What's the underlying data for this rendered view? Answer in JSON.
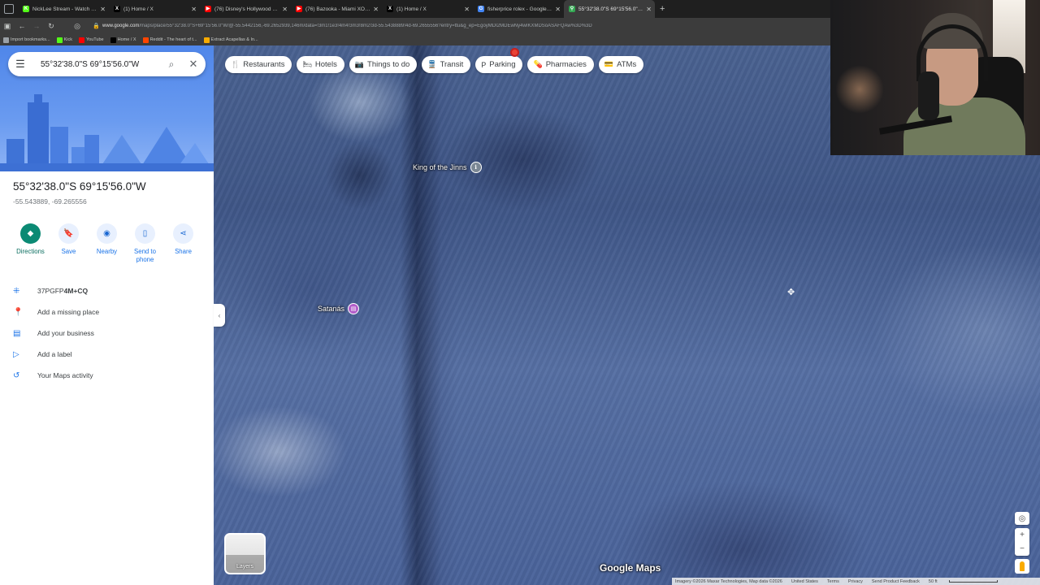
{
  "browser": {
    "tabs": [
      {
        "label": "NickLee Stream - Watch Live on",
        "color": "#53fc18",
        "glyph": "K",
        "active": false
      },
      {
        "label": "(1) Home / X",
        "color": "#000000",
        "glyph": "X",
        "active": false
      },
      {
        "label": "(76) Disney's Hollywood Studio",
        "color": "#ff0000",
        "glyph": "▶",
        "active": false
      },
      {
        "label": "(76) Bazooka - Miami XO [Offic",
        "color": "#ff0000",
        "glyph": "▶",
        "active": false
      },
      {
        "label": "(1) Home / X",
        "color": "#000000",
        "glyph": "X",
        "active": false
      },
      {
        "label": "fisherprice rolex - Google Sear",
        "color": "#4285f4",
        "glyph": "G",
        "active": false
      },
      {
        "label": "55°32'38.0\"S 69°15'56.0\"W - Go",
        "color": "#34a853",
        "glyph": "⚲",
        "active": true
      }
    ],
    "new_tab": "+",
    "url_host": "www.google.com",
    "url_rest": "/maps/place/55°32'38.0\"S+69°15'56.0\"W/@-55.5442156,-69.2652939,146m/data=!3m1!1e3!4m4!3m3!8m2!3d-55.5438889!4d-69.2655556?entry=ttu&g_ep=EgoyMDI2MDEwNy4wIKXMDSoASAFQAw%3D%3D",
    "bookmarks": [
      {
        "label": "Import bookmarks...",
        "color": "#9aa0a6"
      },
      {
        "label": "Kick",
        "color": "#53fc18"
      },
      {
        "label": "YouTube",
        "color": "#ff0000"
      },
      {
        "label": "Home / X",
        "color": "#000000"
      },
      {
        "label": "Reddit - The heart of t...",
        "color": "#ff4500"
      },
      {
        "label": "Extract Acapellas & In...",
        "color": "#f9ab00"
      }
    ]
  },
  "search": {
    "query": "55°32'38.0\"S 69°15'56.0\"W"
  },
  "place": {
    "title": "55°32'38.0\"S 69°15'56.0\"W",
    "decimal": "-55.543889, -69.265556"
  },
  "actions": [
    {
      "label": "Directions",
      "icon": "directions-icon"
    },
    {
      "label": "Save",
      "icon": "bookmark-icon"
    },
    {
      "label": "Nearby",
      "icon": "nearby-icon"
    },
    {
      "label": "Send to phone",
      "icon": "phone-icon"
    },
    {
      "label": "Share",
      "icon": "share-icon"
    }
  ],
  "info_list": [
    {
      "prefix": "37PGFP",
      "bold": "4M+CQ",
      "icon": "plus-code-icon"
    },
    {
      "prefix": "Add a missing place",
      "bold": "",
      "icon": "add-place-icon"
    },
    {
      "prefix": "Add your business",
      "bold": "",
      "icon": "business-icon"
    },
    {
      "prefix": "Add a label",
      "bold": "",
      "icon": "label-icon"
    },
    {
      "prefix": "Your Maps activity",
      "bold": "",
      "icon": "history-icon"
    }
  ],
  "chips": [
    {
      "label": "Restaurants",
      "icon": "🍴"
    },
    {
      "label": "Hotels",
      "icon": "🛏"
    },
    {
      "label": "Things to do",
      "icon": "📷"
    },
    {
      "label": "Transit",
      "icon": "🚆"
    },
    {
      "label": "Parking",
      "icon": "P"
    },
    {
      "label": "Pharmacies",
      "icon": "💊"
    },
    {
      "label": "ATMs",
      "icon": "💳"
    }
  ],
  "map": {
    "places": [
      {
        "label": "King of the Jinns",
        "pin": "grey"
      },
      {
        "label": "Satanás",
        "pin": "purple"
      }
    ],
    "layers_label": "Layers",
    "logo": "Google Maps",
    "footer": [
      "Imagery ©2026 Maxar Technologies, Map data ©2026",
      "United States",
      "Terms",
      "Privacy",
      "Send Product Feedback",
      "50 ft"
    ]
  }
}
